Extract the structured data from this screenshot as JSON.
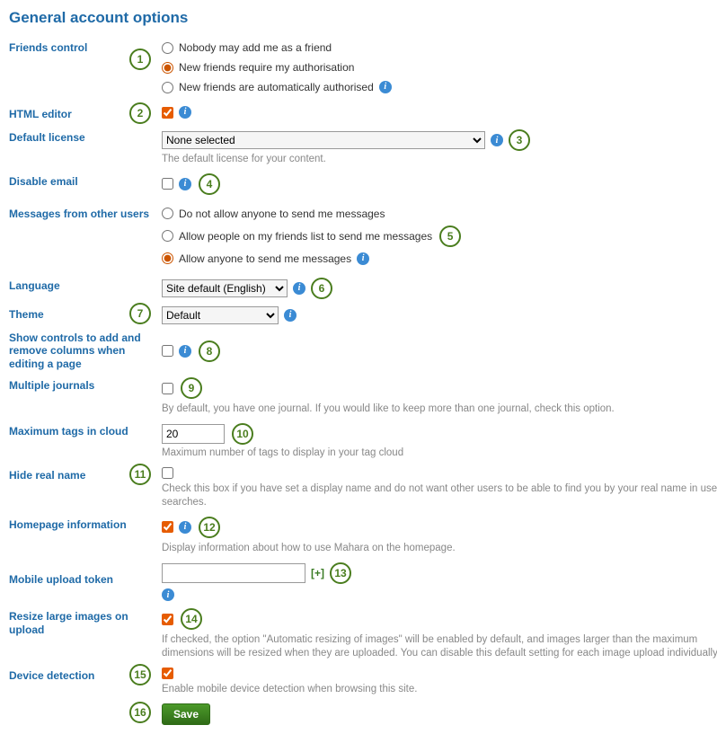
{
  "title": "General account options",
  "rows": {
    "friends": {
      "label": "Friends control",
      "options": {
        "none": "Nobody may add me as a friend",
        "auth": "New friends require my authorisation",
        "auto": "New friends are automatically authorised"
      },
      "callout": "1"
    },
    "htmleditor": {
      "label": "HTML editor",
      "callout": "2"
    },
    "license": {
      "label": "Default license",
      "selected": "None selected",
      "desc": "The default license for your content.",
      "callout": "3"
    },
    "disableemail": {
      "label": "Disable email",
      "callout": "4"
    },
    "messages": {
      "label": "Messages from other users",
      "options": {
        "none": "Do not allow anyone to send me messages",
        "friends": "Allow people on my friends list to send me messages",
        "all": "Allow anyone to send me messages"
      },
      "callout": "5"
    },
    "language": {
      "label": "Language",
      "selected": "Site default (English)",
      "callout": "6"
    },
    "theme": {
      "label": "Theme",
      "selected": "Default",
      "callout": "7"
    },
    "showcols": {
      "label": "Show controls to add and remove columns when editing a page",
      "callout": "8"
    },
    "multijournal": {
      "label": "Multiple journals",
      "desc": "By default, you have one journal. If you would like to keep more than one journal, check this option.",
      "callout": "9"
    },
    "maxtags": {
      "label": "Maximum tags in cloud",
      "value": "20",
      "desc": "Maximum number of tags to display in your tag cloud",
      "callout": "10"
    },
    "hidereal": {
      "label": "Hide real name",
      "desc": "Check this box if you have set a display name and do not want other users to be able to find you by your real name in user searches.",
      "callout": "11"
    },
    "homepage": {
      "label": "Homepage information",
      "desc": "Display information about how to use Mahara on the homepage.",
      "callout": "12"
    },
    "mobiletoken": {
      "label": "Mobile upload token",
      "add": "[+]",
      "callout": "13"
    },
    "resize": {
      "label": "Resize large images on upload",
      "desc": "If checked, the option \"Automatic resizing of images\" will be enabled by default, and images larger than the maximum dimensions will be resized when they are uploaded. You can disable this default setting for each image upload individually.",
      "callout": "14"
    },
    "device": {
      "label": "Device detection",
      "desc": "Enable mobile device detection when browsing this site.",
      "callout": "15"
    },
    "save": {
      "label": "Save",
      "callout": "16"
    }
  }
}
